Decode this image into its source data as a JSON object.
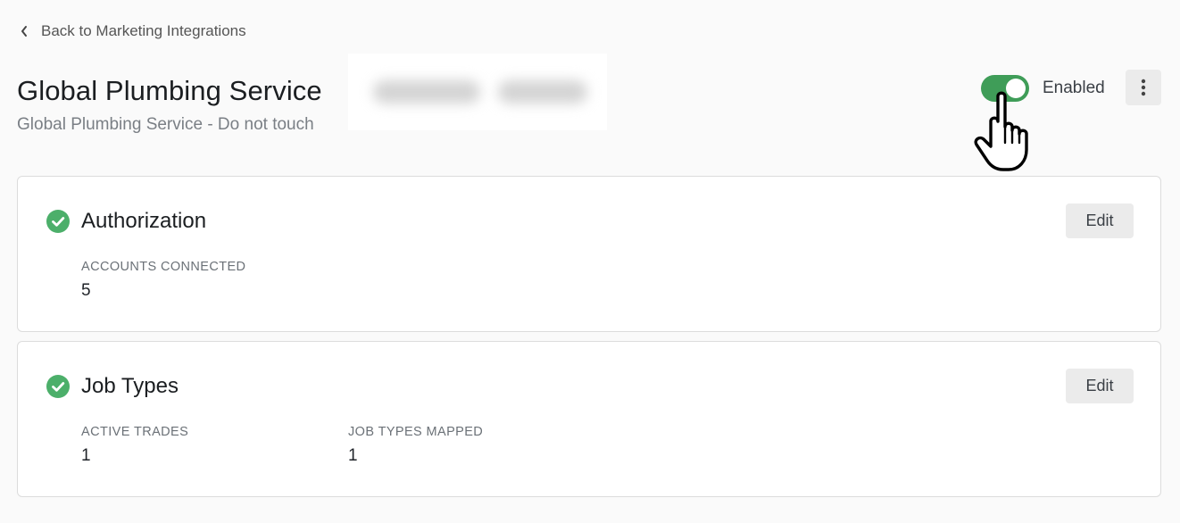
{
  "nav": {
    "back_label": "Back to Marketing Integrations"
  },
  "header": {
    "title": "Global Plumbing Service",
    "subtitle": "Global Plumbing Service - Do not touch",
    "toggle_label": "Enabled",
    "toggle_on": true
  },
  "cards": {
    "authorization": {
      "title": "Authorization",
      "edit_label": "Edit",
      "stats": [
        {
          "label": "ACCOUNTS CONNECTED",
          "value": "5"
        }
      ]
    },
    "job_types": {
      "title": "Job Types",
      "edit_label": "Edit",
      "stats": [
        {
          "label": "ACTIVE TRADES",
          "value": "1"
        },
        {
          "label": "JOB TYPES MAPPED",
          "value": "1"
        }
      ]
    }
  },
  "icons": {
    "back": "chevron-left-icon",
    "more": "more-vertical-icon",
    "status": "check-circle-icon",
    "cursor": "hand-pointer-icon"
  },
  "colors": {
    "accent_green": "#3f9d58",
    "check_green": "#4caf6a",
    "page_bg": "#fafafa"
  }
}
